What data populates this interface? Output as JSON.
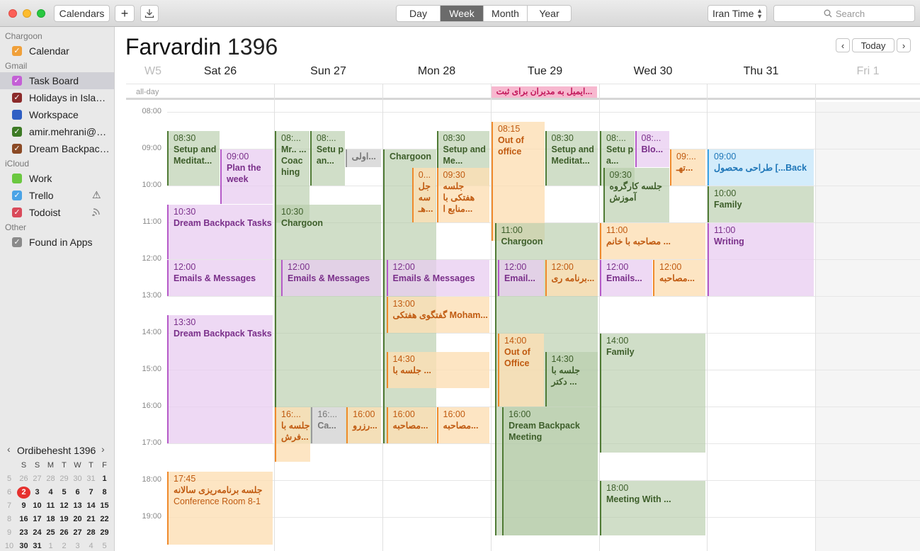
{
  "toolbar": {
    "calendars_label": "Calendars",
    "add_label": "+",
    "views": [
      "Day",
      "Week",
      "Month",
      "Year"
    ],
    "active_view": "Week",
    "timezone": "Iran Time",
    "search_placeholder": "Search"
  },
  "sidebar": {
    "groups": [
      {
        "name": "Chargoon",
        "items": [
          {
            "label": "Calendar",
            "color": "#f0a03a"
          }
        ]
      },
      {
        "name": "Gmail",
        "items": [
          {
            "label": "Task Board",
            "color": "#c45fd6",
            "selected": true
          },
          {
            "label": "Holidays in Isla…",
            "color": "#8b2a2a"
          },
          {
            "label": "Workspace",
            "color": "#2f5fc4",
            "unchecked": true
          },
          {
            "label": "amir.mehrani@…",
            "color": "#3d7a25"
          },
          {
            "label": "Dream Backpac…",
            "color": "#8b4a25"
          }
        ]
      },
      {
        "name": "iCloud",
        "items": [
          {
            "label": "Work",
            "color": "#6bc840",
            "unchecked": true
          },
          {
            "label": "Trello",
            "color": "#4aa3e6",
            "icon": "⚠"
          },
          {
            "label": "Todoist",
            "color": "#d94a5a",
            "icon": "wifi"
          }
        ]
      },
      {
        "name": "Other",
        "items": [
          {
            "label": "Found in Apps",
            "color": "#8a8a8a"
          }
        ]
      }
    ],
    "mini_calendar": {
      "title": "Ordibehesht 1396",
      "weekdays": [
        "S",
        "S",
        "M",
        "T",
        "W",
        "T",
        "F"
      ],
      "weeks": [
        [
          "5",
          "26",
          "27",
          "28",
          "29",
          "30",
          "31",
          "1"
        ],
        [
          "6",
          "2",
          "3",
          "4",
          "5",
          "6",
          "7",
          "8"
        ],
        [
          "7",
          "9",
          "10",
          "11",
          "12",
          "13",
          "14",
          "15"
        ],
        [
          "8",
          "16",
          "17",
          "18",
          "19",
          "20",
          "21",
          "22"
        ],
        [
          "9",
          "23",
          "24",
          "25",
          "26",
          "27",
          "28",
          "29"
        ],
        [
          "10",
          "30",
          "31",
          "1",
          "2",
          "3",
          "4",
          "5"
        ]
      ],
      "today": "2"
    }
  },
  "header": {
    "month": "Farvardin",
    "year": "1396",
    "week_label": "W5",
    "today_label": "Today",
    "prev": "‹",
    "next": "›",
    "days": [
      "Sat 26",
      "Sun 27",
      "Mon 28",
      "Tue 29",
      "Wed 30",
      "Thu 31",
      "Fri 1"
    ],
    "allday_label": "all-day",
    "allday_event": "ایمیل به مدیران برای ثبت..."
  },
  "hours": [
    "08:00",
    "09:00",
    "10:00",
    "11:00",
    "12:00",
    "13:00",
    "14:00",
    "15:00",
    "16:00",
    "17:00",
    "18:00",
    "19:00"
  ],
  "events": [
    {
      "day": 0,
      "s": 8.5,
      "e": 10,
      "l": 0,
      "w": 0.5,
      "c": "g",
      "time": "08:30",
      "title": "Setup and Meditat..."
    },
    {
      "day": 0,
      "s": 9,
      "e": 10.5,
      "l": 0.5,
      "w": 0.5,
      "c": "p",
      "time": "09:00",
      "title": "Plan the week"
    },
    {
      "day": 0,
      "s": 10.5,
      "e": 12,
      "l": 0,
      "w": 1,
      "c": "p",
      "time": "10:30",
      "title": "Dream Backpack Tasks"
    },
    {
      "day": 0,
      "s": 12,
      "e": 13,
      "l": 0,
      "w": 1,
      "c": "p",
      "time": "12:00",
      "title": "Emails & Messages"
    },
    {
      "day": 0,
      "s": 13.5,
      "e": 17,
      "l": 0,
      "w": 1,
      "c": "p",
      "time": "13:30",
      "title": "Dream Backpack Tasks"
    },
    {
      "day": 0,
      "s": 17.75,
      "e": 19.75,
      "l": 0,
      "w": 1,
      "c": "o",
      "time": "17:45",
      "title": "جلسه برنامه‌ریزی سالانه",
      "sub": "Conference Room 8-1"
    },
    {
      "day": 1,
      "s": 8.5,
      "e": 11,
      "l": 0,
      "w": 0.33,
      "c": "g",
      "time": "08:...",
      "title": "Mr.. ... Coac hing"
    },
    {
      "day": 1,
      "s": 8.5,
      "e": 10,
      "l": 0.33,
      "w": 0.33,
      "c": "g",
      "time": "08:...",
      "title": "Setu p an..."
    },
    {
      "day": 1,
      "s": 9,
      "e": 9.5,
      "l": 0.66,
      "w": 0.34,
      "c": "gr",
      "time": "",
      "title": "اولی..."
    },
    {
      "day": 1,
      "s": 10.5,
      "e": 17,
      "l": 0,
      "w": 1,
      "c": "g",
      "time": "10:30",
      "title": "Chargoon"
    },
    {
      "day": 1,
      "s": 12,
      "e": 13,
      "l": 0.06,
      "w": 0.94,
      "c": "p",
      "time": "12:00",
      "title": "Emails & Messages"
    },
    {
      "day": 1,
      "s": 16,
      "e": 17.5,
      "l": 0,
      "w": 0.34,
      "c": "o",
      "time": "16:...",
      "title": "جلسه با فرش..."
    },
    {
      "day": 1,
      "s": 16,
      "e": 17,
      "l": 0.34,
      "w": 0.33,
      "c": "gr",
      "time": "16:...",
      "title": "Ca..."
    },
    {
      "day": 1,
      "s": 16,
      "e": 17,
      "l": 0.67,
      "w": 0.33,
      "c": "o",
      "time": "16:00",
      "title": "رزرو..."
    },
    {
      "day": 2,
      "s": 9,
      "e": 17,
      "l": 0,
      "w": 0.5,
      "c": "g",
      "time": "",
      "title": "Chargoon"
    },
    {
      "day": 2,
      "s": 8.5,
      "e": 10,
      "l": 0.5,
      "w": 0.5,
      "c": "g",
      "time": "08:30",
      "title": "Setup and Me..."
    },
    {
      "day": 2,
      "s": 9.5,
      "e": 11,
      "l": 0.27,
      "w": 0.23,
      "c": "o",
      "time": "0...",
      "title": "جل سه هـ..."
    },
    {
      "day": 2,
      "s": 9.5,
      "e": 11,
      "l": 0.5,
      "w": 0.5,
      "c": "o",
      "time": "09:30",
      "title": "جلسه هفتکی با منابع ا..."
    },
    {
      "day": 2,
      "s": 12,
      "e": 13,
      "l": 0.03,
      "w": 0.97,
      "c": "p",
      "time": "12:00",
      "title": "Emails & Messages"
    },
    {
      "day": 2,
      "s": 13,
      "e": 14,
      "l": 0.03,
      "w": 0.97,
      "c": "o",
      "time": "13:00",
      "title": "گفتگوی هفتکی Moham..."
    },
    {
      "day": 2,
      "s": 14.5,
      "e": 15.5,
      "l": 0.03,
      "w": 0.97,
      "c": "o",
      "time": "14:30",
      "title": "جلسه با ..."
    },
    {
      "day": 2,
      "s": 16,
      "e": 17,
      "l": 0.03,
      "w": 0.47,
      "c": "o",
      "time": "16:00",
      "title": "مصاحبه..."
    },
    {
      "day": 2,
      "s": 16,
      "e": 17,
      "l": 0.5,
      "w": 0.5,
      "c": "o",
      "time": "16:00",
      "title": "مصاحبه..."
    },
    {
      "day": 3,
      "s": 8.25,
      "e": 11.5,
      "l": 0,
      "w": 0.5,
      "c": "o",
      "time": "08:15",
      "title": "Out of office"
    },
    {
      "day": 3,
      "s": 8.5,
      "e": 10,
      "l": 0.5,
      "w": 0.5,
      "c": "g",
      "time": "08:30",
      "title": "Setup and Meditat..."
    },
    {
      "day": 3,
      "s": 11,
      "e": 19.5,
      "l": 0.03,
      "w": 0.97,
      "c": "g",
      "time": "11:00",
      "title": "Chargoon"
    },
    {
      "day": 3,
      "s": 12,
      "e": 13,
      "l": 0.06,
      "w": 0.44,
      "c": "p",
      "time": "12:00",
      "title": "Email..."
    },
    {
      "day": 3,
      "s": 12,
      "e": 13,
      "l": 0.5,
      "w": 0.5,
      "c": "o",
      "time": "12:00",
      "title": "برنامه ری..."
    },
    {
      "day": 3,
      "s": 14,
      "e": 16,
      "l": 0.06,
      "w": 0.44,
      "c": "o",
      "time": "14:00",
      "title": "Out of Office"
    },
    {
      "day": 3,
      "s": 14.5,
      "e": 16,
      "l": 0.5,
      "w": 0.5,
      "c": "g",
      "time": "14:30",
      "title": "جلسه با دکتر ..."
    },
    {
      "day": 3,
      "s": 16,
      "e": 19.5,
      "l": 0.1,
      "w": 0.9,
      "c": "g",
      "time": "16:00",
      "title": "Dream Backpack Meeting"
    },
    {
      "day": 4,
      "s": 8.5,
      "e": 10,
      "l": 0,
      "w": 0.33,
      "c": "g",
      "time": "08:...",
      "title": "Setu p a..."
    },
    {
      "day": 4,
      "s": 8.5,
      "e": 9.5,
      "l": 0.33,
      "w": 0.33,
      "c": "p",
      "time": "08:...",
      "title": "Blo..."
    },
    {
      "day": 4,
      "s": 9,
      "e": 10,
      "l": 0.66,
      "w": 0.34,
      "c": "o",
      "time": "09:...",
      "title": "تهـ..."
    },
    {
      "day": 4,
      "s": 9.5,
      "e": 11,
      "l": 0.03,
      "w": 0.63,
      "c": "g",
      "time": "09:30",
      "title": "جلسه کارگروه آموزش"
    },
    {
      "day": 4,
      "s": 11,
      "e": 12,
      "l": 0,
      "w": 1,
      "c": "o",
      "time": "11:00",
      "title": "مصاحبه با خانم ..."
    },
    {
      "day": 4,
      "s": 12,
      "e": 13,
      "l": 0,
      "w": 0.5,
      "c": "p",
      "time": "12:00",
      "title": "Emails..."
    },
    {
      "day": 4,
      "s": 12,
      "e": 13,
      "l": 0.5,
      "w": 0.5,
      "c": "o",
      "time": "12:00",
      "title": "مصاحبه..."
    },
    {
      "day": 4,
      "s": 14,
      "e": 17.25,
      "l": 0,
      "w": 1,
      "c": "g",
      "time": "14:00",
      "title": "Family"
    },
    {
      "day": 4,
      "s": 18,
      "e": 19.5,
      "l": 0,
      "w": 1,
      "c": "g",
      "time": "18:00",
      "title": "Meeting With ..."
    },
    {
      "day": 5,
      "s": 9,
      "e": 10,
      "l": 0,
      "w": 1,
      "c": "b",
      "time": "09:00",
      "title": "طراحی محصول [...Back"
    },
    {
      "day": 5,
      "s": 10,
      "e": 11,
      "l": 0,
      "w": 1,
      "c": "g",
      "time": "10:00",
      "title": "Family"
    },
    {
      "day": 5,
      "s": 11,
      "e": 13,
      "l": 0,
      "w": 1,
      "c": "p",
      "time": "11:00",
      "title": "Writing"
    }
  ]
}
